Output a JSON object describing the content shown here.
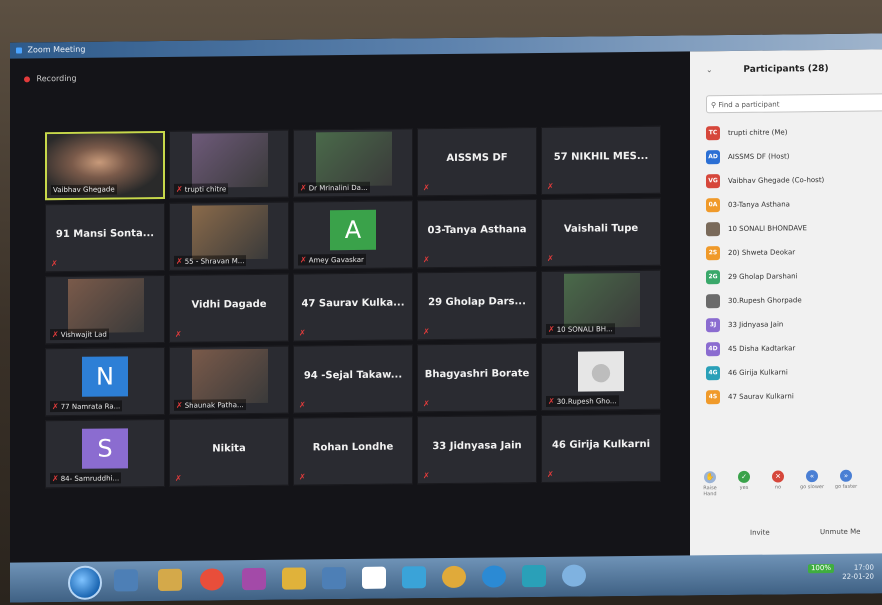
{
  "window": {
    "title": "Zoom Meeting"
  },
  "recording": {
    "label": "Recording"
  },
  "tiles": [
    {
      "name": "Vaibhav Ghegade",
      "kind": "video"
    },
    {
      "name": "trupti chitre",
      "kind": "video"
    },
    {
      "name": "Dr Mrinalini Da...",
      "kind": "video"
    },
    {
      "name": "AISSMS DF",
      "kind": "text"
    },
    {
      "name": "57 NIKHIL MES...",
      "kind": "text"
    },
    {
      "name": "91 Mansi Sonta...",
      "kind": "text"
    },
    {
      "name": "55 - Shravan M...",
      "kind": "video"
    },
    {
      "name": "Amey Gavaskar",
      "kind": "avatar",
      "letter": "A",
      "color": "#3aa24a"
    },
    {
      "name": "03-Tanya Asthana",
      "kind": "text"
    },
    {
      "name": "Vaishali Tupe",
      "kind": "text"
    },
    {
      "name": "Vishwajit Lad",
      "kind": "video"
    },
    {
      "name": "Vidhi Dagade",
      "kind": "text"
    },
    {
      "name": "47 Saurav Kulka...",
      "kind": "text"
    },
    {
      "name": "29 Gholap Dars...",
      "kind": "text"
    },
    {
      "name": "10 SONALI BH...",
      "kind": "video"
    },
    {
      "name": "77 Namrata Ra...",
      "kind": "avatar",
      "letter": "N",
      "color": "#2d7fd6"
    },
    {
      "name": "Shaunak Patha...",
      "kind": "video"
    },
    {
      "name": "94 -Sejal Takaw...",
      "kind": "text"
    },
    {
      "name": "Bhagyashri Borate",
      "kind": "text"
    },
    {
      "name": "30.Rupesh Gho...",
      "kind": "avatar-person"
    },
    {
      "name": "84- Samruddhi...",
      "kind": "avatar",
      "letter": "S",
      "color": "#8b6cd0"
    },
    {
      "name": "Nikita",
      "kind": "text"
    },
    {
      "name": "Rohan Londhe",
      "kind": "text"
    },
    {
      "name": "33 Jidnyasa Jain",
      "kind": "text"
    },
    {
      "name": "46 Girija Kulkarni",
      "kind": "text"
    }
  ],
  "participants": {
    "title": "Participants (28)",
    "search_placeholder": "Find a participant",
    "list": [
      {
        "initials": "TC",
        "name": "trupti chitre (Me)",
        "color": "#d6473b"
      },
      {
        "initials": "AD",
        "name": "AISSMS DF (Host)",
        "color": "#2b6fd4"
      },
      {
        "initials": "VG",
        "name": "Vaibhav Ghegade (Co-host)",
        "color": "#d6473b"
      },
      {
        "initials": "0A",
        "name": "03-Tanya Asthana",
        "color": "#f09a2a"
      },
      {
        "initials": "",
        "name": "10 SONALI BHONDAVE",
        "color": "#7a6a5a"
      },
      {
        "initials": "2S",
        "name": "20) Shweta Deokar",
        "color": "#f09a2a"
      },
      {
        "initials": "2G",
        "name": "29 Gholap Darshani",
        "color": "#3aa86a"
      },
      {
        "initials": "",
        "name": "30.Rupesh Ghorpade",
        "color": "#6b6b6b"
      },
      {
        "initials": "3J",
        "name": "33 Jidnyasa Jain",
        "color": "#8b6cd0"
      },
      {
        "initials": "4D",
        "name": "45 Disha Kadtarkar",
        "color": "#8b6cd0"
      },
      {
        "initials": "4G",
        "name": "46 Girija Kulkarni",
        "color": "#2aa0b8"
      },
      {
        "initials": "4S",
        "name": "47 Saurav Kulkarni",
        "color": "#f09a2a"
      }
    ],
    "reactions": [
      {
        "label": "Raise Hand",
        "glyph": "✋",
        "color": "#9ab3d6"
      },
      {
        "label": "yes",
        "glyph": "✓",
        "color": "#3aa24a"
      },
      {
        "label": "no",
        "glyph": "✕",
        "color": "#d6473b"
      },
      {
        "label": "go slower",
        "glyph": "«",
        "color": "#4a7fd4"
      },
      {
        "label": "go faster",
        "glyph": "»",
        "color": "#4a7fd4"
      }
    ],
    "invite_label": "Invite",
    "unmute_label": "Unmute Me"
  },
  "taskbar": {
    "zoom_level": "100%",
    "time": "17:00",
    "date": "22-01-20"
  }
}
